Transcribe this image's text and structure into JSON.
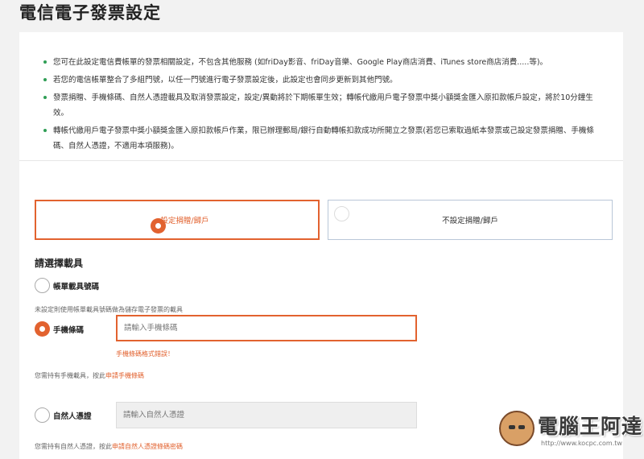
{
  "page": {
    "title": "電信電子發票設定"
  },
  "notes": [
    "您可在此設定電信費帳單的發票相關設定，不包含其他服務 (如friDay影音、friDay音樂、Google Play商店消費、iTunes store商店消費.....等)。",
    "若您的電信帳單整合了多組門號，以任一門號進行電子發票設定後，此設定也會同步更新到其他門號。",
    "發票捐贈、手機條碼、自然人憑證載具及取消發票設定，設定/異動將於下期帳單生效；轉帳代繳用戶電子發票中獎小額獎金匯入原扣款帳戶設定，將於10分鐘生效。",
    "轉帳代繳用戶電子發票中獎小額獎金匯入原扣款帳戶作業，限已辦理郵局/銀行自動轉帳扣款成功所開立之發票(若您已索取過紙本發票或己設定發票捐贈、手機條碼、自然人憑證，不適用本項服務)。"
  ],
  "donation_options": {
    "set": {
      "label": "設定捐贈/歸戶",
      "selected": true
    },
    "unset": {
      "label": "不設定捐贈/歸戶",
      "selected": false
    }
  },
  "carrier": {
    "section_title": "請選擇載具",
    "bill": {
      "label": "帳單載具號碼",
      "selected": false,
      "hint": "未設定則使用帳單載具號碼做為儲存電子發票的載具"
    },
    "mobile": {
      "label": "手機條碼",
      "selected": true,
      "placeholder": "請輸入手機條碼",
      "value": "",
      "error": "手機條碼格式錯誤！",
      "hint_prefix": "您需持有手機載具，按此",
      "hint_link": "申請手機條碼"
    },
    "citizen": {
      "label": "自然人憑證",
      "selected": false,
      "placeholder": "請輸入自然人憑證",
      "value": "",
      "hint_prefix": "您需持有自然人憑證，按此",
      "hint_link": "申請自然人憑證條碼密碼"
    }
  },
  "colors": {
    "accent": "#e2622f",
    "bullet": "#2f9e55",
    "inactive_border": "#b9c7d8"
  },
  "watermark": {
    "title": "電腦王阿達",
    "url": "http://www.kocpc.com.tw"
  }
}
